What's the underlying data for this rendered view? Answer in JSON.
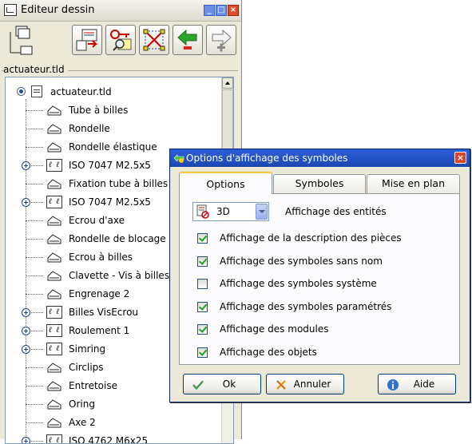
{
  "editor": {
    "title": "Editeur dessin",
    "group_label": "actuateur.tld",
    "tree": {
      "root": "actuateur.tld",
      "items": [
        {
          "label": "Tube à billes",
          "kind": "part",
          "expandable": false
        },
        {
          "label": "Rondelle",
          "kind": "part",
          "expandable": false
        },
        {
          "label": "Rondelle élastique",
          "kind": "part",
          "expandable": false
        },
        {
          "label": "ISO 7047 M2.5x5",
          "kind": "assembly",
          "expandable": true
        },
        {
          "label": "Fixation tube à billes",
          "kind": "part",
          "expandable": false
        },
        {
          "label": "ISO 7047 M2.5x5",
          "kind": "assembly",
          "expandable": true
        },
        {
          "label": "Ecrou d'axe",
          "kind": "part",
          "expandable": false
        },
        {
          "label": "Rondelle de blocage",
          "kind": "part",
          "expandable": false
        },
        {
          "label": "Ecrou à billes",
          "kind": "part",
          "expandable": false
        },
        {
          "label": "Clavette - Vis à billes",
          "kind": "part",
          "expandable": false
        },
        {
          "label": "Engrenage 2",
          "kind": "part",
          "expandable": false
        },
        {
          "label": "Billes VisEcrou",
          "kind": "assembly",
          "expandable": true
        },
        {
          "label": "Roulement 1",
          "kind": "assembly",
          "expandable": true
        },
        {
          "label": "Simring",
          "kind": "assembly",
          "expandable": true
        },
        {
          "label": "Circlips",
          "kind": "part",
          "expandable": false
        },
        {
          "label": "Entretoise",
          "kind": "part",
          "expandable": false
        },
        {
          "label": "Oring",
          "kind": "part",
          "expandable": false
        },
        {
          "label": "Axe 2",
          "kind": "part",
          "expandable": false
        },
        {
          "label": "ISO 4762 M6x25",
          "kind": "assembly",
          "expandable": true
        }
      ]
    }
  },
  "dialog": {
    "title": "Options d'affichage des symboles",
    "tabs": [
      {
        "label": "Options",
        "active": true
      },
      {
        "label": "Symboles",
        "active": false
      },
      {
        "label": "Mise en plan",
        "active": false
      }
    ],
    "display_mode": {
      "value": "3D",
      "label": "Affichage des entités"
    },
    "options": [
      {
        "label": "Affichage de la description des pièces",
        "checked": true
      },
      {
        "label": "Affichage des symboles sans nom",
        "checked": true
      },
      {
        "label": "Affichage des symboles système",
        "checked": false
      },
      {
        "label": "Affichage des symboles paramétrés",
        "checked": true
      },
      {
        "label": "Affichage des modules",
        "checked": true
      },
      {
        "label": "Affichage des objets",
        "checked": true
      }
    ],
    "buttons": {
      "ok": "Ok",
      "cancel": "Annuler",
      "help": "Aide"
    }
  }
}
